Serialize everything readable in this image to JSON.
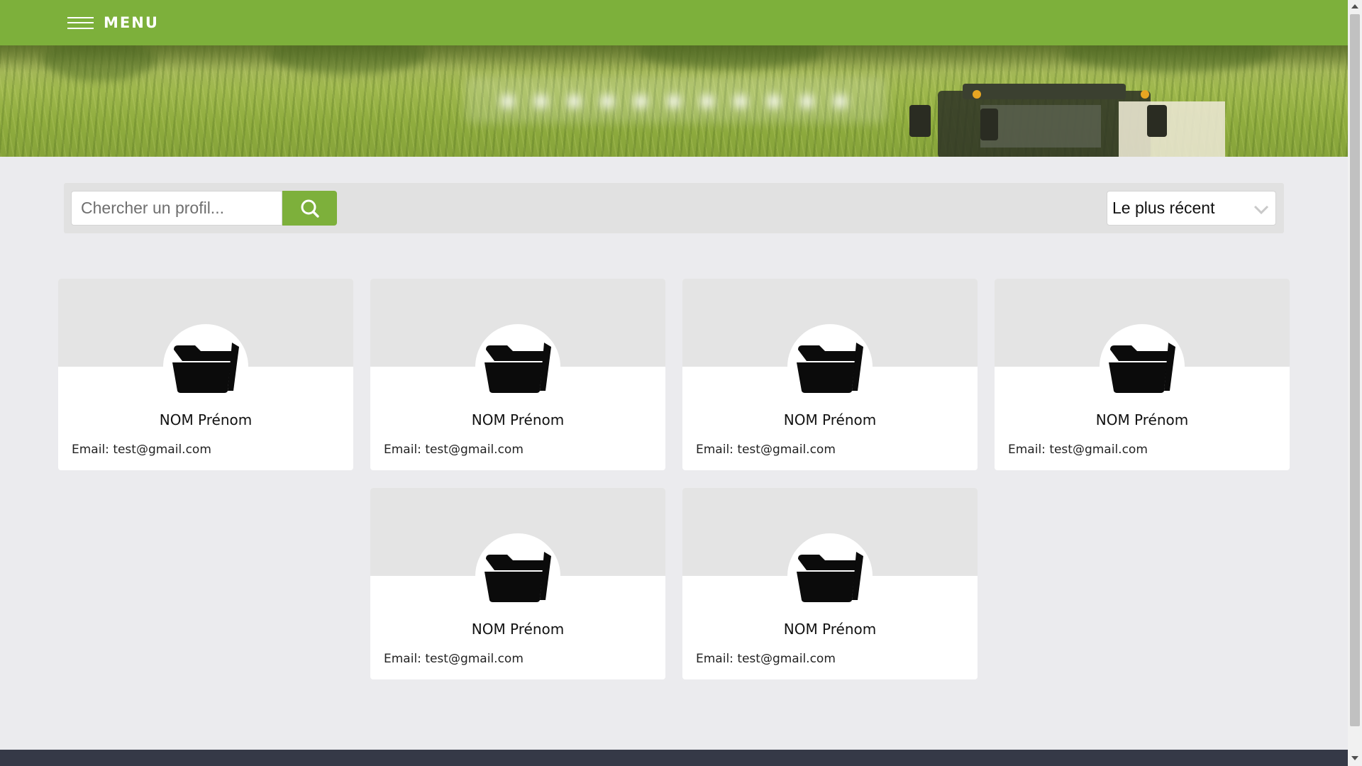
{
  "header": {
    "menu_label": "MENU"
  },
  "search": {
    "placeholder": "Chercher un profil...",
    "value": ""
  },
  "sort": {
    "selected": "Le plus récent"
  },
  "cards": [
    {
      "name": "NOM Prénom",
      "email_label": "Email:",
      "email": "test@gmail.com",
      "icon": "folder-open-icon"
    },
    {
      "name": "NOM Prénom",
      "email_label": "Email:",
      "email": "test@gmail.com",
      "icon": "folder-open-icon"
    },
    {
      "name": "NOM Prénom",
      "email_label": "Email:",
      "email": "test@gmail.com",
      "icon": "folder-open-icon"
    },
    {
      "name": "NOM Prénom",
      "email_label": "Email:",
      "email": "test@gmail.com",
      "icon": "folder-open-icon"
    },
    {
      "name": "NOM Prénom",
      "email_label": "Email:",
      "email": "test@gmail.com",
      "icon": "folder-open-icon"
    },
    {
      "name": "NOM Prénom",
      "email_label": "Email:",
      "email": "test@gmail.com",
      "icon": "folder-open-icon"
    }
  ],
  "colors": {
    "brand_green": "#7db03b",
    "page_background": "#ebebee",
    "footer_background": "#353947"
  }
}
